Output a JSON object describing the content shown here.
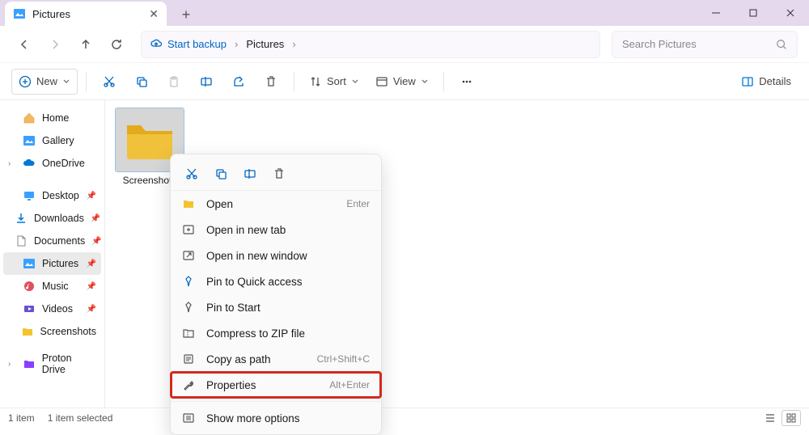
{
  "window": {
    "tab_title": "Pictures"
  },
  "nav": {
    "backup_label": "Start backup",
    "path_segment": "Pictures",
    "search_placeholder": "Search Pictures"
  },
  "toolbar": {
    "new_label": "New",
    "sort_label": "Sort",
    "view_label": "View",
    "details_label": "Details"
  },
  "sidebar": {
    "home": "Home",
    "gallery": "Gallery",
    "onedrive": "OneDrive",
    "desktop": "Desktop",
    "downloads": "Downloads",
    "documents": "Documents",
    "pictures": "Pictures",
    "music": "Music",
    "videos": "Videos",
    "screenshots": "Screenshots",
    "proton": "Proton Drive"
  },
  "main": {
    "folder_name": "Screenshots"
  },
  "ctx": {
    "open": "Open",
    "open_shortcut": "Enter",
    "open_tab": "Open in new tab",
    "open_win": "Open in new window",
    "pin_quick": "Pin to Quick access",
    "pin_start": "Pin to Start",
    "compress": "Compress to ZIP file",
    "copy_path": "Copy as path",
    "copy_path_shortcut": "Ctrl+Shift+C",
    "properties": "Properties",
    "properties_shortcut": "Alt+Enter",
    "show_more": "Show more options"
  },
  "status": {
    "count": "1 item",
    "selected": "1 item selected"
  }
}
